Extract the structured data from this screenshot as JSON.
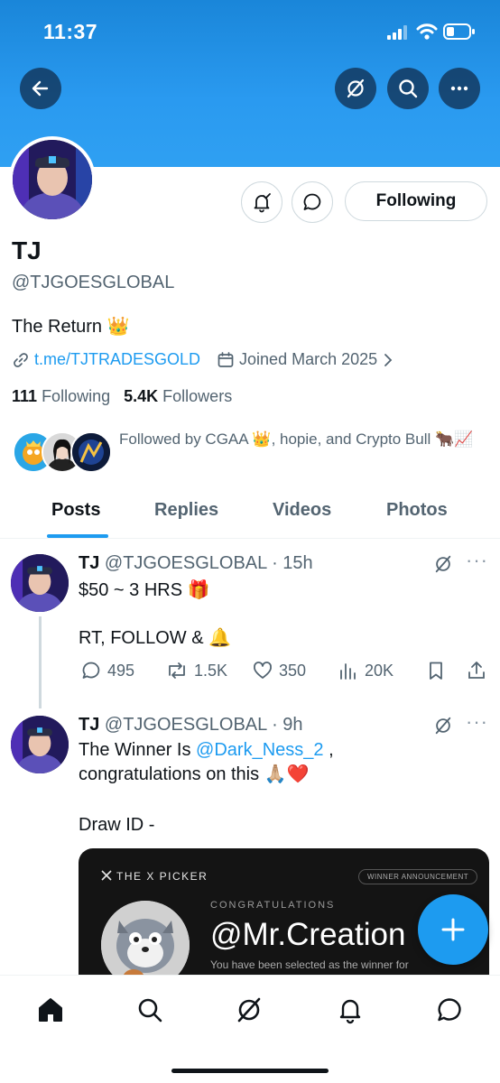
{
  "status_bar": {
    "time": "11:37"
  },
  "profile": {
    "name": "TJ",
    "handle": "@TJGOESGLOBAL",
    "bio": "The Return 👑",
    "link": "t.me/TJTRADESGOLD",
    "joined": "Joined March 2025",
    "following_count": "111",
    "following_label": "Following",
    "followers_count": "5.4K",
    "followers_label": "Followers",
    "followed_by": "Followed by CGAA 👑, hopie, and Crypto Bull 🐂📈",
    "follow_button_label": "Following"
  },
  "tabs": [
    {
      "label": "Posts",
      "active": true
    },
    {
      "label": "Replies"
    },
    {
      "label": "Videos"
    },
    {
      "label": "Photos"
    }
  ],
  "posts": [
    {
      "author": "TJ",
      "handle": "@TJGOESGLOBAL",
      "time": "15h",
      "line1": "$50 ~ 3 HRS 🎁",
      "line2": "RT, FOLLOW & 🔔",
      "replies": "495",
      "reposts": "1.5K",
      "likes": "350",
      "views": "20K"
    },
    {
      "author": "TJ",
      "handle": "@TJGOESGLOBAL",
      "time": "9h",
      "line1_prefix": "The Winner Is ",
      "mention": "@Dark_Ness_2",
      "line1_suffix": " ,",
      "line2": "congratulations on this 🙏🏼❤️",
      "line3": "Draw ID -",
      "card": {
        "brand": "THE X PICKER",
        "badge": "WINNER ANNOUNCEMENT",
        "kicker": "CONGRATULATIONS",
        "winner": "@Mr.Creation",
        "subtitle": "You have been selected as the winner for"
      }
    }
  ],
  "colors": {
    "accent": "#1d9bf0",
    "banner": "#2a9af0",
    "text": "#0f1419",
    "muted": "#536471"
  }
}
